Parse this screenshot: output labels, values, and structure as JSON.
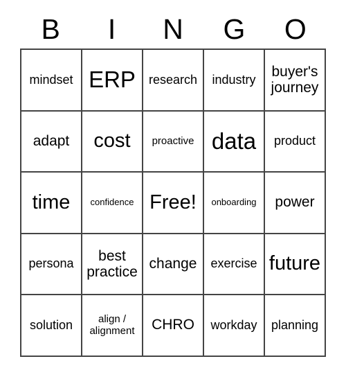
{
  "card": {
    "title": "BINGO",
    "header_letters": [
      "B",
      "I",
      "N",
      "G",
      "O"
    ],
    "free_space_label": "Free!",
    "grid_line_color": "#444444",
    "text_color": "#000000",
    "background_color": "#ffffff",
    "columns": 5,
    "rows": 5,
    "cells": [
      {
        "text": "mindset",
        "size": "sm",
        "row": 1,
        "col": 1,
        "free": false
      },
      {
        "text": "ERP",
        "size": "xl",
        "row": 1,
        "col": 2,
        "free": false
      },
      {
        "text": "research",
        "size": "sm",
        "row": 1,
        "col": 3,
        "free": false
      },
      {
        "text": "industry",
        "size": "sm",
        "row": 1,
        "col": 4,
        "free": false
      },
      {
        "text": "buyer's journey",
        "size": "md",
        "row": 1,
        "col": 5,
        "free": false
      },
      {
        "text": "adapt",
        "size": "md",
        "row": 2,
        "col": 1,
        "free": false
      },
      {
        "text": "cost",
        "size": "lg",
        "row": 2,
        "col": 2,
        "free": false
      },
      {
        "text": "proactive",
        "size": "xs",
        "row": 2,
        "col": 3,
        "free": false
      },
      {
        "text": "data",
        "size": "xl",
        "row": 2,
        "col": 4,
        "free": false
      },
      {
        "text": "product",
        "size": "sm",
        "row": 2,
        "col": 5,
        "free": false
      },
      {
        "text": "time",
        "size": "lg",
        "row": 3,
        "col": 1,
        "free": false
      },
      {
        "text": "confidence",
        "size": "xxs",
        "row": 3,
        "col": 2,
        "free": false
      },
      {
        "text": "Free!",
        "size": "lg",
        "row": 3,
        "col": 3,
        "free": true
      },
      {
        "text": "onboarding",
        "size": "xxs",
        "row": 3,
        "col": 4,
        "free": false
      },
      {
        "text": "power",
        "size": "md",
        "row": 3,
        "col": 5,
        "free": false
      },
      {
        "text": "persona",
        "size": "sm",
        "row": 4,
        "col": 1,
        "free": false
      },
      {
        "text": "best practice",
        "size": "md",
        "row": 4,
        "col": 2,
        "free": false
      },
      {
        "text": "change",
        "size": "md",
        "row": 4,
        "col": 3,
        "free": false
      },
      {
        "text": "exercise",
        "size": "sm",
        "row": 4,
        "col": 4,
        "free": false
      },
      {
        "text": "future",
        "size": "lg",
        "row": 4,
        "col": 5,
        "free": false
      },
      {
        "text": "solution",
        "size": "sm",
        "row": 5,
        "col": 1,
        "free": false
      },
      {
        "text": "align / alignment",
        "size": "xs",
        "row": 5,
        "col": 2,
        "free": false
      },
      {
        "text": "CHRO",
        "size": "md",
        "row": 5,
        "col": 3,
        "free": false
      },
      {
        "text": "workday",
        "size": "sm",
        "row": 5,
        "col": 4,
        "free": false
      },
      {
        "text": "planning",
        "size": "sm",
        "row": 5,
        "col": 5,
        "free": false
      }
    ]
  }
}
